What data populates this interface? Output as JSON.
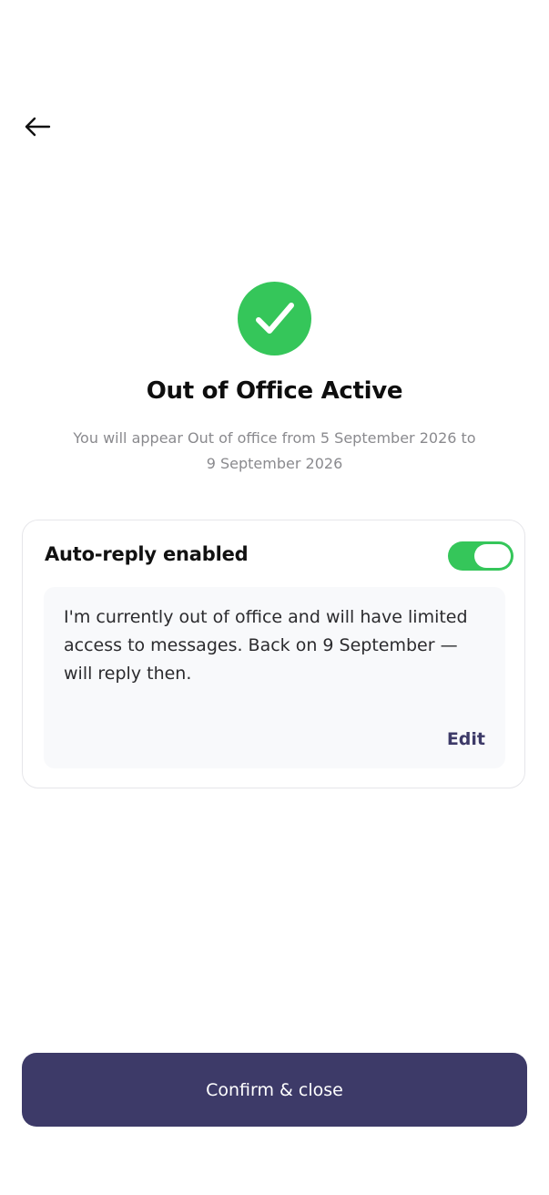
{
  "header": {
    "back_icon": "arrow-left-icon"
  },
  "status": {
    "icon": "check-icon",
    "title": "Out of Office Active",
    "subtitle": "You will appear Out of office from 5 September 2026 to 9 September 2026"
  },
  "auto_reply": {
    "label": "Auto-reply enabled",
    "enabled": true,
    "message": "I'm currently out of office and will have limited access to messages. Back on 9 September — will reply then.",
    "edit_label": "Edit"
  },
  "footer": {
    "confirm_label": "Confirm & close"
  },
  "colors": {
    "success": "#35c65a",
    "primary": "#3d3a68",
    "toggle_on": "#35c65a"
  }
}
